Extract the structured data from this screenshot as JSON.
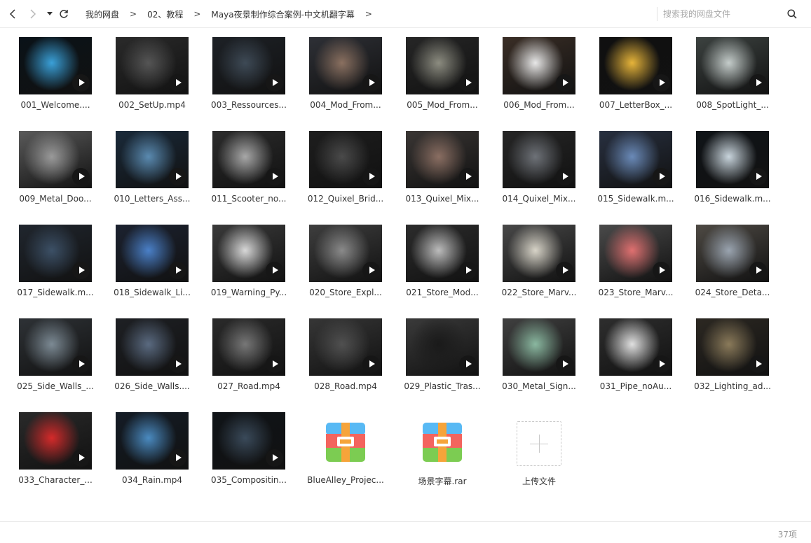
{
  "breadcrumb": [
    "我的网盘",
    "02、教程",
    "Maya夜景制作综合案例-中文机翻字幕"
  ],
  "search": {
    "placeholder": "搜索我的网盘文件"
  },
  "files": [
    {
      "name": "001_Welcome....",
      "type": "video",
      "bg": "#0a1218",
      "accent": "#3aa0d8"
    },
    {
      "name": "002_SetUp.mp4",
      "type": "video",
      "bg": "#2a2a2a",
      "accent": "#555555"
    },
    {
      "name": "003_Ressources...",
      "type": "video",
      "bg": "#1d2126",
      "accent": "#3e4a56"
    },
    {
      "name": "004_Mod_From...",
      "type": "video",
      "bg": "#2e3036",
      "accent": "#8a7060"
    },
    {
      "name": "005_Mod_From...",
      "type": "video",
      "bg": "#262626",
      "accent": "#8c8c80"
    },
    {
      "name": "006_Mod_From...",
      "type": "video",
      "bg": "#3a2e26",
      "accent": "#e8e8e8"
    },
    {
      "name": "007_LetterBox_...",
      "type": "video",
      "bg": "#101010",
      "accent": "#e6b43a"
    },
    {
      "name": "008_SpotLight_...",
      "type": "video",
      "bg": "#3c4240",
      "accent": "#c4ccca"
    },
    {
      "name": "009_Metal_Doo...",
      "type": "video",
      "bg": "#5a5a5a",
      "accent": "#9a9a9a"
    },
    {
      "name": "010_Letters_Ass...",
      "type": "video",
      "bg": "#1a2a3a",
      "accent": "#5a8ab0"
    },
    {
      "name": "011_Scooter_no...",
      "type": "video",
      "bg": "#2c2c2c",
      "accent": "#a8a8a8"
    },
    {
      "name": "012_Quixel_Brid...",
      "type": "video",
      "bg": "#1e1e1e",
      "accent": "#4a4a4a"
    },
    {
      "name": "013_Quixel_Mix...",
      "type": "video",
      "bg": "#3a3634",
      "accent": "#8a6e62"
    },
    {
      "name": "014_Quixel_Mix...",
      "type": "video",
      "bg": "#262626",
      "accent": "#6e7278"
    },
    {
      "name": "015_Sidewalk.m...",
      "type": "video",
      "bg": "#283040",
      "accent": "#6a8ab8"
    },
    {
      "name": "016_Sidewalk.m...",
      "type": "video",
      "bg": "#101418",
      "accent": "#c8d4dc"
    },
    {
      "name": "017_Sidewalk.m...",
      "type": "video",
      "bg": "#20262e",
      "accent": "#3c5066"
    },
    {
      "name": "018_Sidewalk_Li...",
      "type": "video",
      "bg": "#1c2230",
      "accent": "#4a80c8"
    },
    {
      "name": "019_Warning_Py...",
      "type": "video",
      "bg": "#3a3a3a",
      "accent": "#d8d8d8"
    },
    {
      "name": "020_Store_Expl...",
      "type": "video",
      "bg": "#3e3e3e",
      "accent": "#8a8a8a"
    },
    {
      "name": "021_Store_Mod...",
      "type": "video",
      "bg": "#2c2c2c",
      "accent": "#bcbcbc"
    },
    {
      "name": "022_Store_Marv...",
      "type": "video",
      "bg": "#484848",
      "accent": "#d8d4c8"
    },
    {
      "name": "023_Store_Marv...",
      "type": "video",
      "bg": "#4a4a4a",
      "accent": "#e07070"
    },
    {
      "name": "024_Store_Deta...",
      "type": "video",
      "bg": "#4e4a44",
      "accent": "#9aa4b0"
    },
    {
      "name": "025_Side_Walls_...",
      "type": "video",
      "bg": "#2e3236",
      "accent": "#7c8a94"
    },
    {
      "name": "026_Side_Walls....",
      "type": "video",
      "bg": "#1e2024",
      "accent": "#5a6a80"
    },
    {
      "name": "027_Road.mp4",
      "type": "video",
      "bg": "#2a2a2a",
      "accent": "#777777"
    },
    {
      "name": "028_Road.mp4",
      "type": "video",
      "bg": "#363636",
      "accent": "#505050"
    },
    {
      "name": "029_Plastic_Tras...",
      "type": "video",
      "bg": "#3a3a3a",
      "accent": "#1a1a1a"
    },
    {
      "name": "030_Metal_Sign...",
      "type": "video",
      "bg": "#404040",
      "accent": "#8ab8a0"
    },
    {
      "name": "031_Pipe_noAu...",
      "type": "video",
      "bg": "#2e2e2e",
      "accent": "#e0e0e0"
    },
    {
      "name": "032_Lighting_ad...",
      "type": "video",
      "bg": "#2c2822",
      "accent": "#8a7a5a"
    },
    {
      "name": "033_Character_...",
      "type": "video",
      "bg": "#2a2a2a",
      "accent": "#d42a2a"
    },
    {
      "name": "034_Rain.mp4",
      "type": "video",
      "bg": "#141c26",
      "accent": "#4a8ac0"
    },
    {
      "name": "035_Compositin...",
      "type": "video",
      "bg": "#101418",
      "accent": "#3a4a5a"
    },
    {
      "name": "BlueAlley_Projec...",
      "type": "archive"
    },
    {
      "name": "场景字幕.rar",
      "type": "archive"
    }
  ],
  "upload": {
    "label": "上传文件"
  },
  "archive_colors": [
    "#58b9f4",
    "#f3645e",
    "#7ccc52",
    "#f6a43a"
  ],
  "footer": {
    "count": "37项"
  }
}
